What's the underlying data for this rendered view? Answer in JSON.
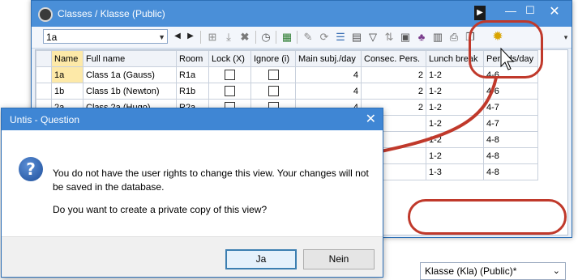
{
  "window": {
    "title": "Classes / Klasse (Public)",
    "minimize": "—",
    "maximize": "☐",
    "close": "✕",
    "play": "▶"
  },
  "toolbar": {
    "class_value": "1a",
    "dropdown_glyph": "▼",
    "prev": "◀",
    "next": "▶"
  },
  "grid": {
    "columns": [
      "Name",
      "Full name",
      "Room",
      "Lock (X)",
      "Ignore (i)",
      "Main subj./day",
      "Consec. Pers.",
      "Lunch break",
      "Periods/day"
    ],
    "rows": [
      {
        "name": "1a",
        "full": "Class 1a (Gauss)",
        "room": "R1a",
        "main": "4",
        "consec": "2",
        "lunch": "1-2",
        "periods": "4-6"
      },
      {
        "name": "1b",
        "full": "Class 1b (Newton)",
        "room": "R1b",
        "main": "4",
        "consec": "2",
        "lunch": "1-2",
        "periods": "4-6"
      },
      {
        "name": "2a",
        "full": "Class 2a (Hugo)",
        "room": "R2a",
        "main": "4",
        "consec": "2",
        "lunch": "1-2",
        "periods": "4-7"
      },
      {
        "name": "",
        "full": "",
        "room": "",
        "main": "",
        "consec": "",
        "lunch": "1-2",
        "periods": "4-7"
      },
      {
        "name": "",
        "full": "",
        "room": "",
        "main": "",
        "consec": "",
        "lunch": "1-2",
        "periods": "4-8"
      },
      {
        "name": "",
        "full": "",
        "room": "",
        "main": "",
        "consec": "",
        "lunch": "1-2",
        "periods": "4-8"
      },
      {
        "name": "",
        "full": "",
        "room": "",
        "main": "",
        "consec": "",
        "lunch": "1-3",
        "periods": "4-8"
      }
    ]
  },
  "view_selector": {
    "value": "Klasse (Kla) (Public)*",
    "dropdown_glyph": "⌄"
  },
  "dialog": {
    "title": "Untis - Question",
    "close": "✕",
    "icon": "?",
    "message_line1": "You do not have the user rights to change this view. Your changes will not be saved in the database.",
    "message_line2": "Do you want to create a private copy of this view?",
    "yes_label": "Ja",
    "no_label": "Nein"
  },
  "colors": {
    "highlight": "#c0392b",
    "title_blue": "#4a8fd8",
    "selected_header": "#fde9a8"
  }
}
